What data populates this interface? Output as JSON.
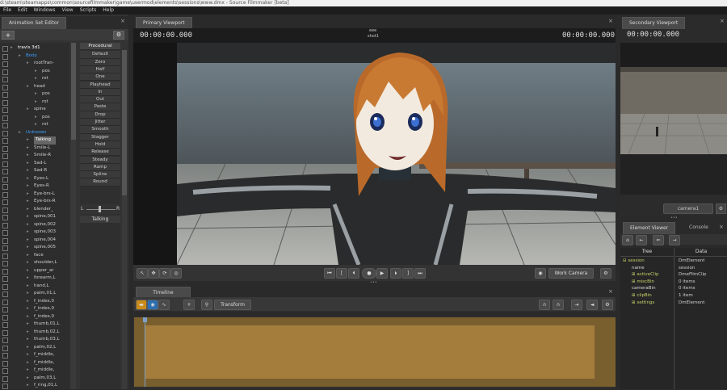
{
  "window": {
    "title": "d:\\steam\\steamapps\\common\\sourcefilmmaker\\game\\usermod\\elements\\sessions\\www.dmx - Source Filmmaker [beta]"
  },
  "menu": [
    "File",
    "Edit",
    "Windows",
    "View",
    "Scripts",
    "Help"
  ],
  "anim_set_editor": {
    "tab": "Animation Set Editor",
    "tree": [
      {
        "label": "travis 3d1",
        "color": "#ffffff"
      },
      {
        "label": "Body",
        "color": "#3aa0ff"
      },
      {
        "label": "rootTran-",
        "color": "#cfcfcf"
      },
      {
        "label": "pos",
        "color": "#cfcfcf"
      },
      {
        "label": "rot",
        "color": "#cfcfcf"
      },
      {
        "label": "head",
        "color": "#cfcfcf"
      },
      {
        "label": "pos",
        "color": "#cfcfcf"
      },
      {
        "label": "rot",
        "color": "#cfcfcf"
      },
      {
        "label": "spine",
        "color": "#cfcfcf"
      },
      {
        "label": "pos",
        "color": "#cfcfcf"
      },
      {
        "label": "rot",
        "color": "#cfcfcf"
      },
      {
        "label": "Unknown",
        "color": "#3aa0ff"
      },
      {
        "label": "Talking",
        "color": "#ffffff"
      },
      {
        "label": "Smile-L",
        "color": "#cfcfcf"
      },
      {
        "label": "Smile-R",
        "color": "#cfcfcf"
      },
      {
        "label": "Sad-L",
        "color": "#cfcfcf"
      },
      {
        "label": "Sad-R",
        "color": "#cfcfcf"
      },
      {
        "label": "Eyes-L",
        "color": "#cfcfcf"
      },
      {
        "label": "Eyes-R",
        "color": "#cfcfcf"
      },
      {
        "label": "Eye-brs-L",
        "color": "#cfcfcf"
      },
      {
        "label": "Eye-brs-R",
        "color": "#cfcfcf"
      },
      {
        "label": "blender_",
        "color": "#cfcfcf"
      },
      {
        "label": "spine,001",
        "color": "#cfcfcf"
      },
      {
        "label": "spine,002",
        "color": "#cfcfcf"
      },
      {
        "label": "spine,003",
        "color": "#cfcfcf"
      },
      {
        "label": "spine,004",
        "color": "#cfcfcf"
      },
      {
        "label": "spine,005",
        "color": "#cfcfcf"
      },
      {
        "label": "face",
        "color": "#cfcfcf"
      },
      {
        "label": "shoulder,L",
        "color": "#cfcfcf"
      },
      {
        "label": "upper_ar",
        "color": "#cfcfcf"
      },
      {
        "label": "forearm,L",
        "color": "#cfcfcf"
      },
      {
        "label": "hand,L",
        "color": "#cfcfcf"
      },
      {
        "label": "palm,01,L",
        "color": "#cfcfcf"
      },
      {
        "label": "f_index,0",
        "color": "#cfcfcf"
      },
      {
        "label": "f_index,0",
        "color": "#cfcfcf"
      },
      {
        "label": "f_index,0",
        "color": "#cfcfcf"
      },
      {
        "label": "thumb,01,L",
        "color": "#cfcfcf"
      },
      {
        "label": "thumb,02,L",
        "color": "#cfcfcf"
      },
      {
        "label": "thumb,03,L",
        "color": "#cfcfcf"
      },
      {
        "label": "palm,02,L",
        "color": "#cfcfcf"
      },
      {
        "label": "f_middle,",
        "color": "#cfcfcf"
      },
      {
        "label": "f_middle,",
        "color": "#cfcfcf"
      },
      {
        "label": "f_middle,",
        "color": "#cfcfcf"
      },
      {
        "label": "palm,03,L",
        "color": "#cfcfcf"
      },
      {
        "label": "f_ring,01,L",
        "color": "#cfcfcf"
      }
    ],
    "procedural": {
      "header": "Procedural",
      "buttons": [
        "Default",
        "Zero",
        "Half",
        "One",
        "Playhead",
        "In",
        "Out",
        "Paste",
        "Drop",
        "Jitter",
        "Smooth",
        "Stagger",
        "Hold",
        "Release",
        "Steady",
        "Ramp",
        "Spline",
        "Round"
      ],
      "slider_left": "L",
      "slider_right": "R",
      "current": "Talking"
    }
  },
  "primary_viewport": {
    "tab": "Primary Viewport",
    "time_left": "00:00:00.000",
    "time_right": "00:00:00.000",
    "shot_dots": "eee",
    "shot_name": "shot1",
    "camera": "Work Camera"
  },
  "timeline": {
    "tab": "Timeline",
    "mode": "Transform"
  },
  "secondary_viewport": {
    "tab": "Secondary Viewport",
    "time": "00:00:00.000",
    "camera": "camera1"
  },
  "element_viewer": {
    "tab": "Element Viewer",
    "tab2": "Console",
    "col_tree": "Tree",
    "col_data": "Data",
    "rows": [
      {
        "tree": "session",
        "data": "DmElement"
      },
      {
        "tree": "name",
        "data": "session"
      },
      {
        "tree": "activeClip",
        "data": "DmeFilmClip"
      },
      {
        "tree": "miscBin",
        "data": "0 items"
      },
      {
        "tree": "cameraBin",
        "data": "0 items"
      },
      {
        "tree": "clipBin",
        "data": "1 item"
      },
      {
        "tree": "settings",
        "data": "DmElement"
      }
    ]
  }
}
